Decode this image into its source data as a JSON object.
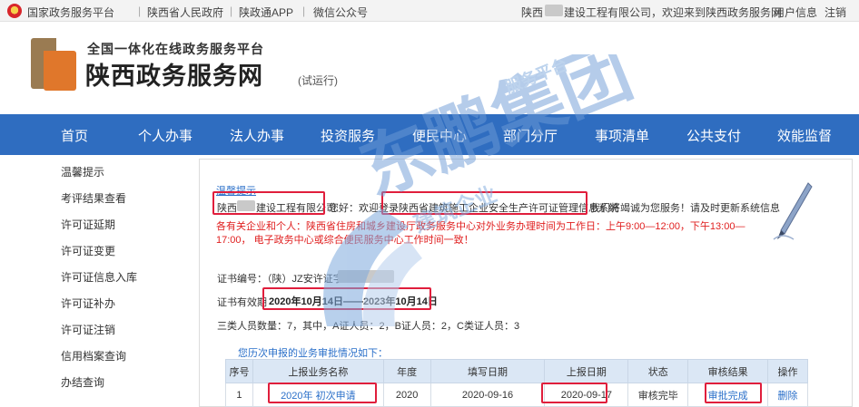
{
  "topbar": {
    "links": [
      "国家政务服务平台",
      "陕西省人民政府",
      "陕政通APP",
      "微信公众号"
    ],
    "welcome": "陕西",
    "welcome_suffix": "建设工程有限公司，欢迎来到陕西政务服务网",
    "user_info": "用户信息",
    "logout": "注销"
  },
  "header": {
    "platform": "全国一体化在线政务服务平台",
    "site_name": "陕西政务服务网",
    "trial": "(试运行)"
  },
  "nav": [
    "首页",
    "个人办事",
    "法人办事",
    "投资服务",
    "便民中心",
    "部门分厅",
    "事项清单",
    "公共支付",
    "效能监督"
  ],
  "sidebar": [
    "温馨提示",
    "考评结果查看",
    "许可证延期",
    "许可证变更",
    "许可证信息入库",
    "许可证补办",
    "许可证注销",
    "信用档案查询",
    "办结查询"
  ],
  "content": {
    "tip_title": "温馨提示",
    "company_prefix": "陕西",
    "company_suffix": "建设工程有限公司",
    "greeting": "您好：欢迎登录陕西省建筑施工企业安全生产许可证管理信息系统",
    "greeting_suffix": "我们将竭诚为您服务！请及时更新系统信息",
    "notice": "各有关企业和个人：陕西省住房和城乡建设厅政务服务中心对外业务办理时间为工作日：上午9:00—12:00，下午13:00—17:00，  电子政务中心或综合便民服务中心工作时间一致！",
    "cert_label": "证书编号：（陕）JZ安许证字",
    "validity_label": "证书有效期",
    "validity_value": "2020年10月14日——2023年10月14日",
    "staff": "三类人员数量：7，其中，A证人员：2，B证人员：2，C类证人员：3",
    "history_title": "您历次申报的业务审批情况如下："
  },
  "table": {
    "headers": [
      "序号",
      "上报业务名称",
      "年度",
      "填写日期",
      "上报日期",
      "状态",
      "审核结果",
      "操作"
    ],
    "rows": [
      [
        "1",
        "2020年 初次申请",
        "2020",
        "2020-09-16",
        "2020-09-17",
        "审核完毕",
        "审批完成",
        "删除"
      ]
    ]
  },
  "watermark": {
    "main": "东鹏集团",
    "sub1": "建筑企业",
    "sub2": "服务平台"
  },
  "colors": {
    "nav_bg": "#2f6dc0",
    "highlight": "#e01e3c",
    "link": "#2a6fc9",
    "notice": "#e02020"
  }
}
